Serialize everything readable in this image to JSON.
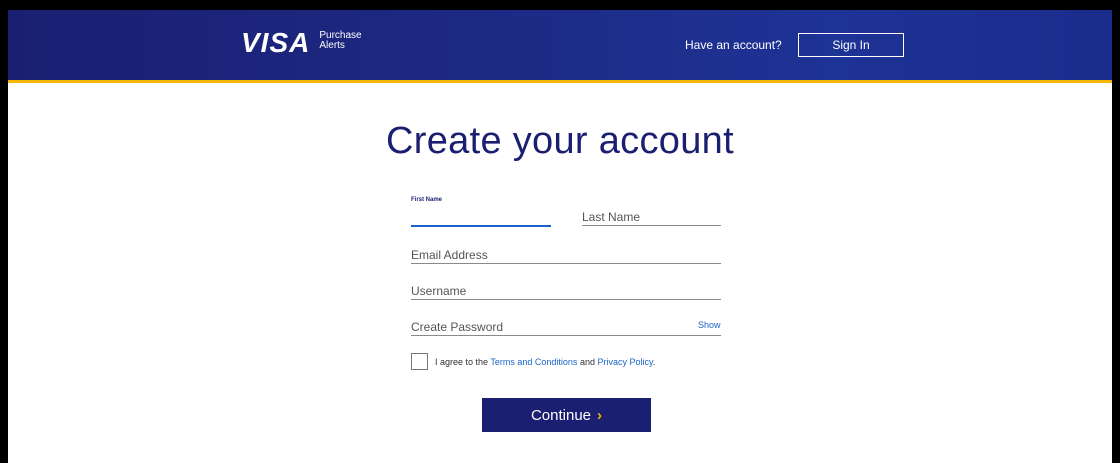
{
  "header": {
    "logo_word": "VISA",
    "logo_sub_line1": "Purchase",
    "logo_sub_line2": "Alerts",
    "account_prompt": "Have an account?",
    "signin_label": "Sign In"
  },
  "colors": {
    "brand_blue": "#1a1f71",
    "accent_gold": "#f7b600",
    "link_blue": "#1a64c8"
  },
  "form": {
    "title": "Create your account",
    "first_name": {
      "label": "First Name",
      "value": ""
    },
    "last_name": {
      "placeholder": "Last Name"
    },
    "email": {
      "placeholder": "Email Address"
    },
    "username": {
      "placeholder": "Username"
    },
    "password": {
      "placeholder": "Create Password",
      "toggle_label": "Show"
    },
    "agree": {
      "prefix": "I agree to the ",
      "terms_link": "Terms and Conditions",
      "middle": " and ",
      "privacy_link": "Privacy Policy",
      "suffix": "."
    },
    "continue_label": "Continue",
    "continue_icon": "chevron-right-icon"
  }
}
